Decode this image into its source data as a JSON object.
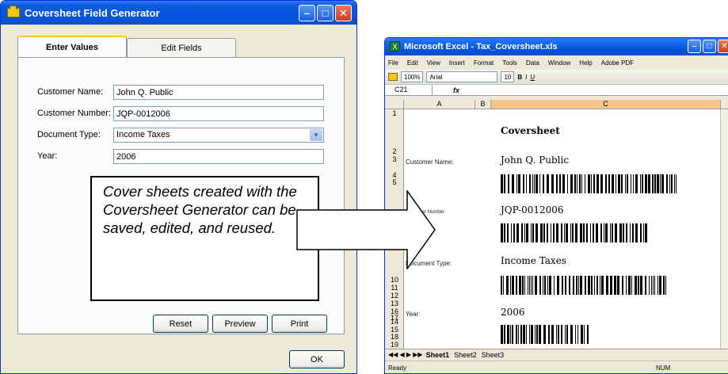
{
  "dialog": {
    "title": "Coversheet Field Generator",
    "tabs": [
      "Enter Values",
      "Edit Fields"
    ],
    "fields": [
      {
        "label": "Customer Name:",
        "value": "John Q. Public"
      },
      {
        "label": "Customer Number:",
        "value": "JQP-0012006"
      },
      {
        "label": "Document Type:",
        "value": "Income Taxes"
      },
      {
        "label": "Year:",
        "value": "2006"
      }
    ],
    "buttons": {
      "reset": "Reset",
      "preview": "Preview",
      "print": "Print",
      "ok": "OK"
    }
  },
  "callout": {
    "text": "Cover sheets created with the Coversheet Generator can be saved, edited, and reused."
  },
  "excel": {
    "title": "Microsoft Excel - Tax_Coversheet.xls",
    "menu": [
      "File",
      "Edit",
      "View",
      "Insert",
      "Format",
      "Tools",
      "Data",
      "Window",
      "Help",
      "Adobe PDF"
    ],
    "zoom": "100%",
    "font": "Arial",
    "font_size": "10",
    "cell_ref": "C21",
    "fx": "fx",
    "columns": [
      "A",
      "B",
      "C"
    ],
    "rows": [
      "1",
      "2",
      "3",
      "4",
      "5",
      "6",
      "7",
      "8",
      "9",
      "10",
      "11",
      "12",
      "13",
      "14",
      "15",
      "16",
      "17",
      "18",
      "19"
    ],
    "heading": "Coversheet",
    "labels": [
      "Customer Name:",
      "Customer Number:",
      "Document Type:",
      "Year:"
    ],
    "values": [
      "John Q. Public",
      "JQP-0012006",
      "Income Taxes",
      "2006"
    ],
    "sheets": [
      "Sheet1",
      "Sheet2",
      "Sheet3"
    ],
    "status": "Ready",
    "num": "NUM"
  }
}
